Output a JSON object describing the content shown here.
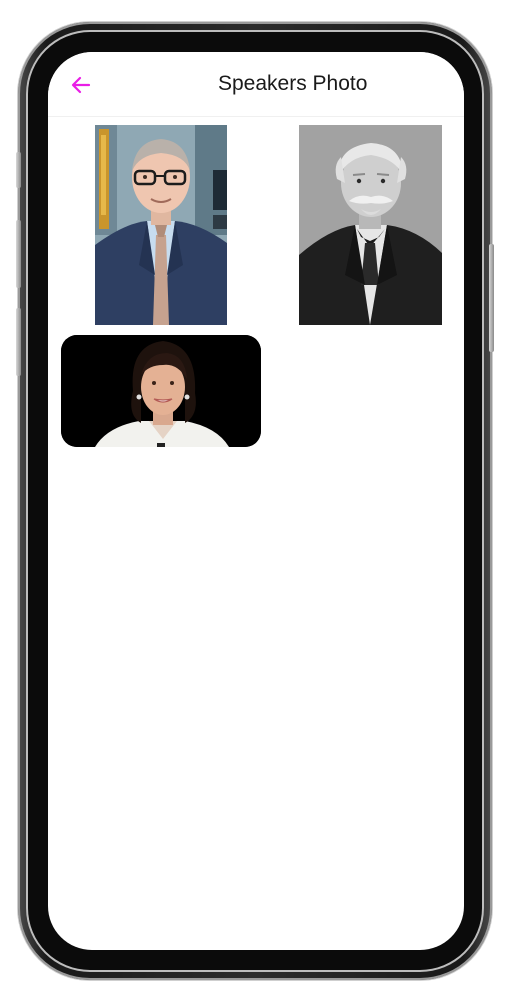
{
  "app_bar": {
    "title": "Speakers Photo",
    "back_icon": "arrow-left-icon",
    "accent_color": "#e91ee6"
  },
  "gallery": {
    "photos": [
      {
        "subject": "man-with-glasses-blue-suit",
        "style": "color"
      },
      {
        "subject": "elderly-man-with-mustache",
        "style": "black-and-white"
      },
      {
        "subject": "woman-white-jacket",
        "style": "color"
      }
    ]
  }
}
